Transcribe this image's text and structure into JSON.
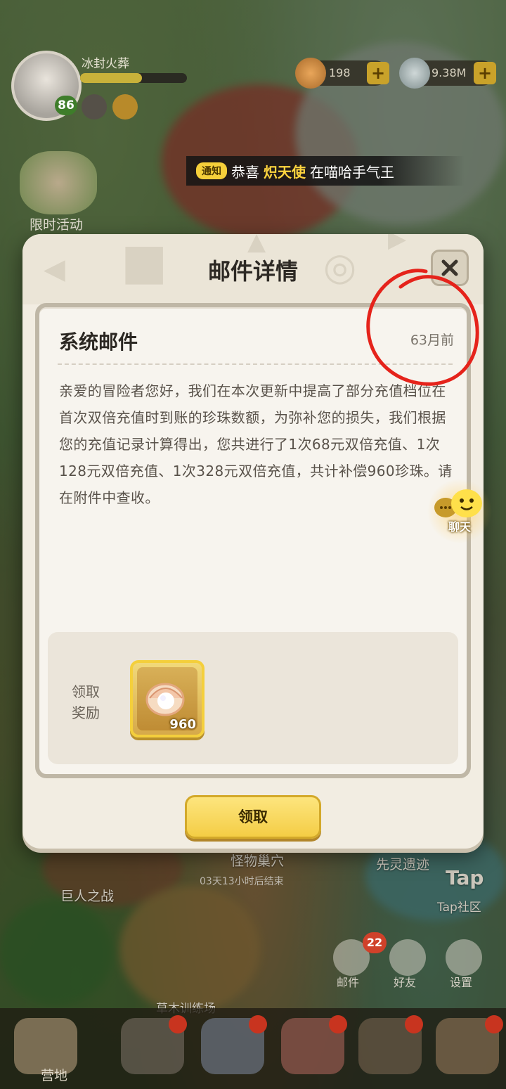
{
  "hud": {
    "player_name": "冰封火葬",
    "level": "86",
    "pearl_count": "198",
    "gold_count": "9.38M",
    "plus": "+"
  },
  "notice": {
    "tag": "通知",
    "prefix": "恭喜",
    "highlight": "炽天使",
    "suffix": "在喵哈手气王"
  },
  "event": {
    "label": "限时活动"
  },
  "background_labels": {
    "monster_nest": "怪物巢穴",
    "timer": "03天13小时后结束",
    "pioneer_ruins": "先灵遗迹",
    "giant_battle": "巨人之战",
    "tap_community": "Tap社区",
    "tap_logo": "Tap",
    "training_ground": "草木训练场"
  },
  "side_buttons": {
    "mail": "邮件",
    "mail_badge": "22",
    "friends": "好友",
    "settings": "设置"
  },
  "bottom_nav": {
    "camp": "营地"
  },
  "modal": {
    "title": "邮件详情",
    "mail_title": "系统邮件",
    "mail_date": "63月前",
    "mail_body": "亲爱的冒险者您好，我们在本次更新中提高了部分充值档位在首次双倍充值时到账的珍珠数额，为弥补您的损失，我们根据您的充值记录计算得出，您共进行了1次68元双倍充值、1次128元双倍充值、1次328元双倍充值，共计补偿960珍珠。请在附件中查收。",
    "reward_label": "领取奖励",
    "reward_quantity": "960",
    "reward_icon": "pearl-shell-icon",
    "claim_button": "领取"
  },
  "chat": {
    "label": "聊天"
  },
  "colors": {
    "accent_yellow": "#f4cd45",
    "annotation_red": "#e5231b",
    "modal_bg": "#f2ede2"
  }
}
